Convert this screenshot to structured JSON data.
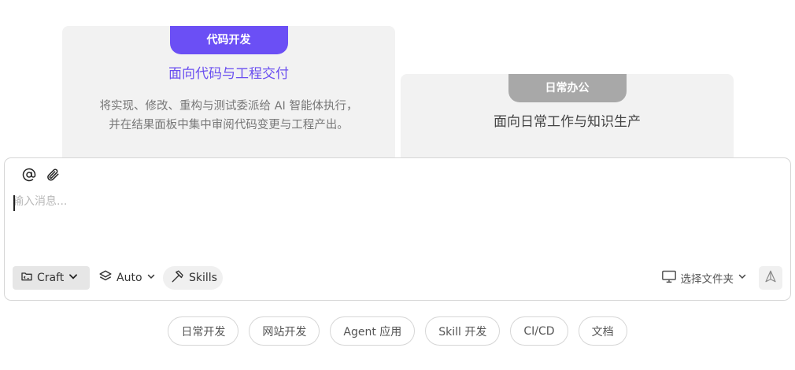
{
  "cards": {
    "dev": {
      "tab": "代码开发",
      "title": "面向代码与工程交付",
      "desc_line1": "将实现、修改、重构与测试委派给 AI 智能体执行，",
      "desc_line2": "并在结果面板中集中审阅代码变更与工程产出。",
      "accent": "#6b4ff5"
    },
    "office": {
      "tab": "日常办公",
      "title": "面向日常工作与知识生产",
      "tab_color": "#a8a8a8"
    }
  },
  "composer": {
    "placeholder": "输入消息...",
    "toolbar": {
      "mention_icon": "at-icon",
      "attach_icon": "paperclip-icon"
    },
    "mode_label": "Craft",
    "model_label": "Auto",
    "skills_label": "Skills",
    "folder_label": "选择文件夹"
  },
  "chips": [
    "日常开发",
    "网站开发",
    "Agent 应用",
    "Skill 开发",
    "CI/CD",
    "文档"
  ]
}
